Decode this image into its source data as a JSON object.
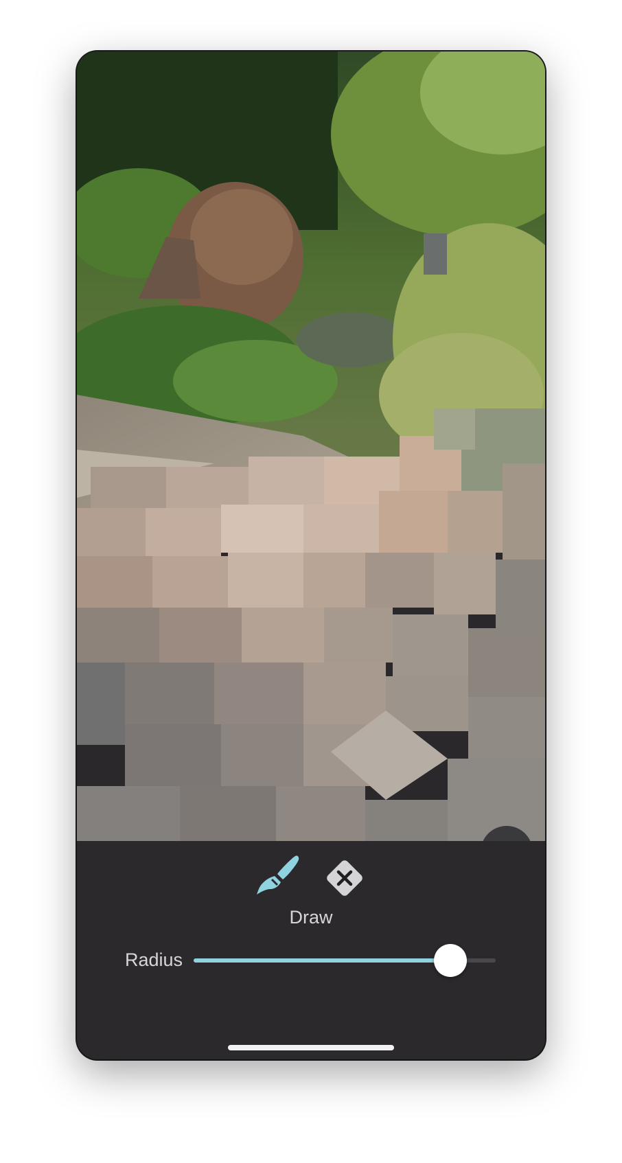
{
  "toolbar": {
    "draw_tool_icon": "paintbrush-icon",
    "erase_tool_icon": "clear-diamond-icon",
    "mode_label": "Draw"
  },
  "radius": {
    "label": "Radius",
    "value_fraction": 0.85
  },
  "colors": {
    "accent": "#8fd3e0",
    "panel_background": "#2b292c",
    "label_text": "#d6d6d8"
  }
}
